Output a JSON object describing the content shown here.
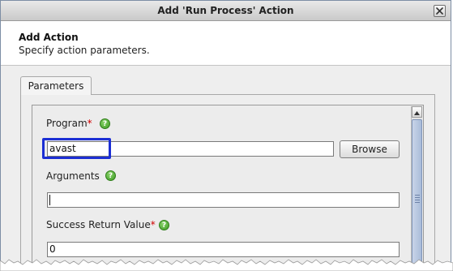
{
  "window": {
    "title": "Add 'Run Process' Action",
    "close_icon": "close-icon"
  },
  "header": {
    "title": "Add Action",
    "subtitle": "Specify action parameters."
  },
  "tabs": [
    {
      "label": "Parameters",
      "active": true
    }
  ],
  "form": {
    "program": {
      "label": "Program",
      "required_marker": "*",
      "value": "avast",
      "browse_label": "Browse",
      "help_icon": "help-icon"
    },
    "arguments": {
      "label": "Arguments",
      "value": "",
      "help_icon": "help-icon"
    },
    "success_return_value": {
      "label": "Success Return Value",
      "required_marker": "*",
      "value": "0",
      "help_icon": "help-icon"
    }
  },
  "colors": {
    "highlight_box": "#1c2fd4",
    "required": "#d00000",
    "help_icon": "#3c9a22"
  }
}
